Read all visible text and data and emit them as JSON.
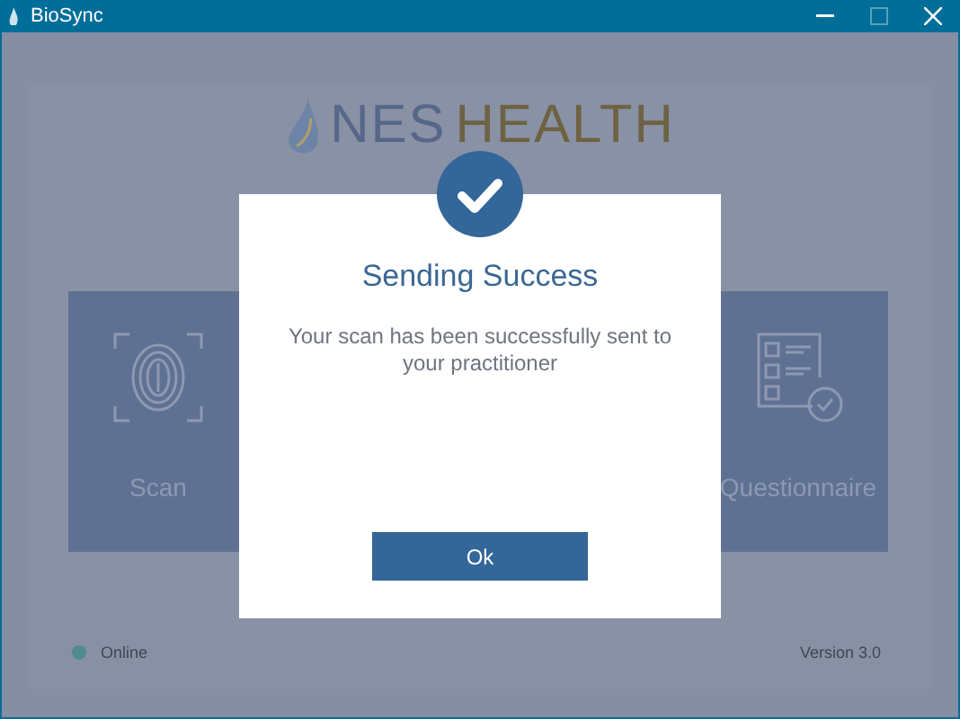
{
  "window": {
    "title": "BioSync"
  },
  "logo": {
    "brand": "NES",
    "word": "HEALTH"
  },
  "tiles": [
    {
      "kind": "scan",
      "label": "Scan"
    },
    {
      "kind": "questionnaire",
      "label": "Questionnaire"
    }
  ],
  "status_bar": {
    "online": true,
    "label": "Online",
    "version": "Version 3.0"
  },
  "dialog": {
    "title": "Sending Success",
    "message": "Your scan has been successfully sent to your practitioner",
    "button": "Ok"
  }
}
